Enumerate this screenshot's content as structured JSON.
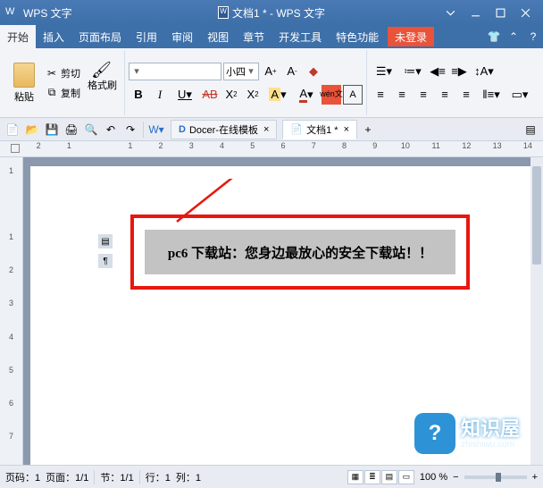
{
  "titlebar": {
    "app": "WPS 文字",
    "doc": "文档1 * - WPS 文字"
  },
  "menu": {
    "items": [
      "开始",
      "插入",
      "页面布局",
      "引用",
      "审阅",
      "视图",
      "章节",
      "开发工具",
      "特色功能"
    ],
    "login": "未登录"
  },
  "ribbon": {
    "paste": "粘贴",
    "cut": "剪切",
    "copy": "复制",
    "format_painter": "格式刷",
    "font_name": "",
    "font_size": "小四",
    "bold": "B",
    "italic": "I",
    "underline": "U",
    "strike": "AB",
    "x2": "X",
    "sup": "2",
    "x2b": "X",
    "sub": "2",
    "Aplus": "A",
    "Aminus": "A",
    "phonetic_wen": "wén",
    "phonetic_zi": "文"
  },
  "qat": {
    "docer": "Docer-在线模板",
    "doc1": "文档1 *"
  },
  "ruler_h": [
    "2",
    "1",
    "",
    "1",
    "2",
    "3",
    "4",
    "5",
    "6",
    "7",
    "8",
    "9",
    "10",
    "11",
    "12",
    "13",
    "14"
  ],
  "ruler_v": [
    "1",
    "",
    "1",
    "2",
    "3",
    "4",
    "5",
    "6",
    "7"
  ],
  "content": {
    "text": "pc6 下载站：您身边最放心的安全下载站！！"
  },
  "status": {
    "page": "页码：1",
    "page_val": "页面：1/1",
    "section": "节：1/1",
    "pos": "",
    "row": "行：1",
    "col": "列：1",
    "zoom": "100 %",
    "minus": "−",
    "plus": "+"
  },
  "watermark": {
    "brand": "知识屋",
    "url": "zhishiwu.com",
    "q": "?"
  }
}
